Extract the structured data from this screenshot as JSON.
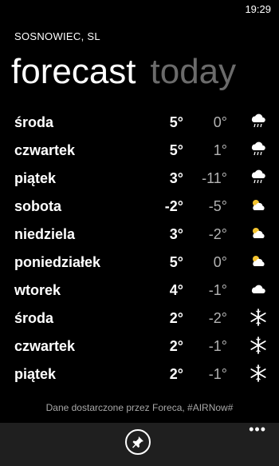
{
  "status": {
    "time": "19:29"
  },
  "location": "SOSNOWIEC, SL",
  "pivot": {
    "active": "forecast",
    "next": "today"
  },
  "forecast": [
    {
      "day": "środa",
      "high": "5°",
      "low": "0°",
      "icon": "rain-cloud-icon"
    },
    {
      "day": "czwartek",
      "high": "5°",
      "low": "1°",
      "icon": "rain-cloud-icon"
    },
    {
      "day": "piątek",
      "high": "3°",
      "low": "-11°",
      "icon": "rain-cloud-icon"
    },
    {
      "day": "sobota",
      "high": "-2°",
      "low": "-5°",
      "icon": "partly-cloudy-icon"
    },
    {
      "day": "niedziela",
      "high": "3°",
      "low": "-2°",
      "icon": "partly-cloudy-icon"
    },
    {
      "day": "poniedziałek",
      "high": "5°",
      "low": "0°",
      "icon": "partly-cloudy-icon"
    },
    {
      "day": "wtorek",
      "high": "4°",
      "low": "-1°",
      "icon": "cloud-icon"
    },
    {
      "day": "środa",
      "high": "2°",
      "low": "-2°",
      "icon": "snowflake-icon"
    },
    {
      "day": "czwartek",
      "high": "2°",
      "low": "-1°",
      "icon": "snowflake-icon"
    },
    {
      "day": "piątek",
      "high": "2°",
      "low": "-1°",
      "icon": "snowflake-icon"
    }
  ],
  "footer": "Dane dostarczone przez Foreca, #AIRNow#",
  "appbar": {
    "pin_icon": "pin-icon",
    "more_label": "•••"
  }
}
